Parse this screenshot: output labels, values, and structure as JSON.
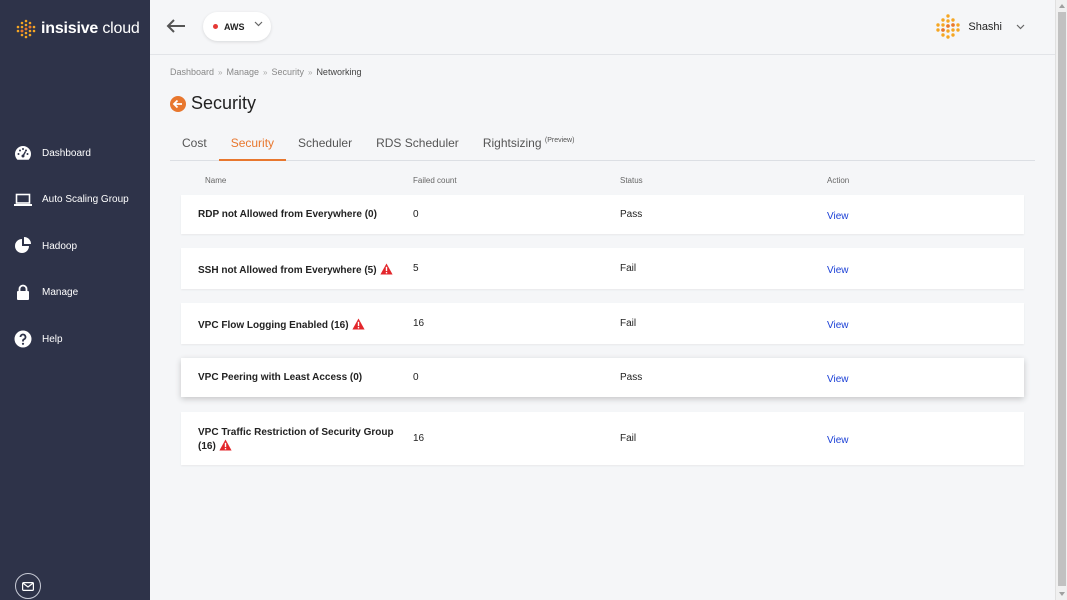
{
  "app": {
    "logo_text_bold": "insisive",
    "logo_text_light": " cloud"
  },
  "sidebar": {
    "items": [
      {
        "label": "Dashboard",
        "icon": "dashboard-gauge-icon"
      },
      {
        "label": "Auto Scaling Group",
        "icon": "laptop-icon"
      },
      {
        "label": "Hadoop",
        "icon": "pie-chart-icon"
      },
      {
        "label": "Manage",
        "icon": "lock-icon"
      },
      {
        "label": "Help",
        "icon": "question-circle-icon"
      }
    ],
    "mail_icon": "mail-icon"
  },
  "header": {
    "cloud_provider": "AWS",
    "cloud_status_color": "#e53935",
    "user_name": "Shashi"
  },
  "breadcrumb": [
    "Dashboard",
    "Manage",
    "Security",
    "Networking"
  ],
  "page": {
    "title": "Security",
    "accent_color": "#e8772e"
  },
  "tabs": [
    {
      "label": "Cost",
      "active": false
    },
    {
      "label": "Security",
      "active": true
    },
    {
      "label": "Scheduler",
      "active": false
    },
    {
      "label": "RDS Scheduler",
      "active": false
    },
    {
      "label": "Rightsizing",
      "sup": "(Preview)",
      "active": false
    }
  ],
  "table": {
    "columns": [
      "Name",
      "Failed count",
      "Status",
      "Action"
    ],
    "rows": [
      {
        "name": "RDP not Allowed from Everywhere (0)",
        "warning": false,
        "failed_count": "0",
        "status": "Pass",
        "action": "View"
      },
      {
        "name": "SSH not Allowed from Everywhere (5)",
        "warning": true,
        "failed_count": "5",
        "status": "Fail",
        "action": "View"
      },
      {
        "name": "VPC Flow Logging Enabled (16)",
        "warning": true,
        "failed_count": "16",
        "status": "Fail",
        "action": "View"
      },
      {
        "name": "VPC Peering with Least Access (0)",
        "warning": false,
        "failed_count": "0",
        "status": "Pass",
        "action": "View"
      },
      {
        "name": "VPC Traffic Restriction of Security Group (16)",
        "warning": true,
        "failed_count": "16",
        "status": "Fail",
        "action": "View"
      }
    ]
  }
}
